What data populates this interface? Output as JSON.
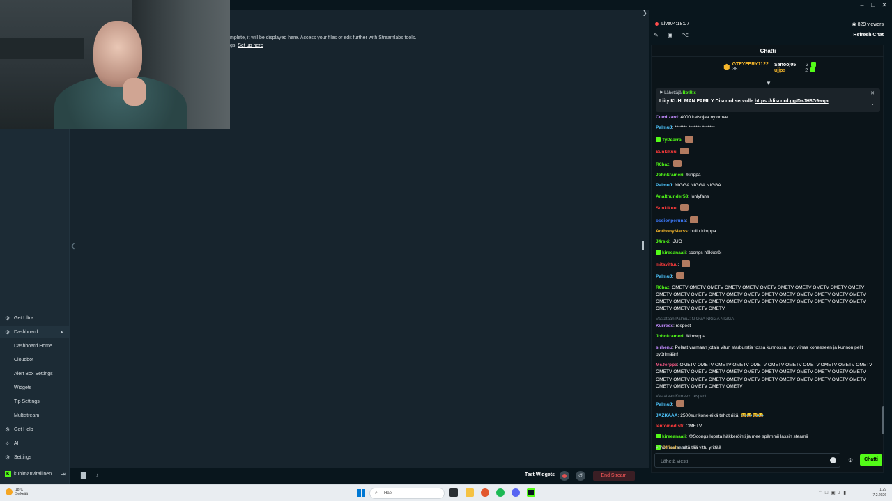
{
  "window": {
    "minimize": "–",
    "maximize": "□",
    "close": "✕"
  },
  "notice": {
    "line1": "mplete, it will be displayed here. Access your files or edit further with Streamlabs tools.",
    "line2_prefix": "gs.",
    "setup_link": "Set up here"
  },
  "sidebar": {
    "items": [
      {
        "label": "Get Ultra",
        "icon": "ultra-icon"
      },
      {
        "label": "Dashboard",
        "icon": "dashboard-icon"
      },
      {
        "label": "Dashboard Home"
      },
      {
        "label": "Cloudbot"
      },
      {
        "label": "Alert Box Settings"
      },
      {
        "label": "Widgets"
      },
      {
        "label": "Tip Settings"
      },
      {
        "label": "Multistream"
      },
      {
        "label": "Get Help",
        "icon": "help-icon"
      },
      {
        "label": "AI",
        "icon": "ai-icon"
      },
      {
        "label": "Settings",
        "icon": "gear-icon"
      }
    ],
    "user": "kuhlmanvirallinen",
    "user_logo": "K"
  },
  "bottombar": {
    "test_widgets": "Test Widgets",
    "end_stream": "End Stream"
  },
  "chat_panel": {
    "live_label": "Live",
    "live_time": "04:18:07",
    "viewers": "829 viewers",
    "refresh": "Refresh Chat",
    "title": "Chatti",
    "gifters": {
      "left_name": "GTFYFERY1122",
      "left_count": "38",
      "right": [
        {
          "name": "Sanooj05",
          "count": "2"
        },
        {
          "name": "ujjps",
          "count": "2"
        }
      ]
    },
    "pinned": {
      "sender_label": "Lähettäjä",
      "sender": "BotRix",
      "message": "Liity KUHLMAN FAMILY Discord servulle",
      "link": "https://discord.gg/DaJH8G9wqa"
    },
    "messages": [
      {
        "user": "Cumlizard",
        "color": "#c48cff",
        "text": "4000 katsojaa ny omee !"
      },
      {
        "user": "PalmuJ",
        "color": "#4fc7ff",
        "text": "******* ******* *******"
      },
      {
        "user": "TyPearra",
        "color": "#53fc18",
        "text": "",
        "badge": true,
        "emote": true
      },
      {
        "user": "Sunkikuu",
        "color": "#ff3b3b",
        "text": "",
        "emote": true
      },
      {
        "user": "R0baz",
        "color": "#53fc18",
        "text": "",
        "emote": true
      },
      {
        "user": "Johnkrameri",
        "color": "#53fc18",
        "text": "!kinppa"
      },
      {
        "user": "PalmuJ",
        "color": "#4fc7ff",
        "text": "NIGGA NIGGA NIGGA"
      },
      {
        "user": "Analthunder58",
        "color": "#53fc18",
        "text": "!onlyfans"
      },
      {
        "user": "Sunkikuu",
        "color": "#ff3b3b",
        "text": "",
        "emote": true
      },
      {
        "user": "ossionperuna",
        "color": "#3d7bff",
        "text": "",
        "emote": true
      },
      {
        "user": "AnthonyMarss",
        "color": "#f5b62b",
        "text": "huilu kimppa"
      },
      {
        "user": "J4rski",
        "color": "#53fc18",
        "text": "!JUO"
      },
      {
        "user": "kireeanaali",
        "color": "#53fc18",
        "text": "scongs häkkeröi",
        "badge": true
      },
      {
        "user": "mitavittuu",
        "color": "#ff3b3b",
        "text": "",
        "emote": true
      },
      {
        "user": "PalmuJ",
        "color": "#4fc7ff",
        "text": "",
        "emote": true
      },
      {
        "user": "R0baz",
        "color": "#53fc18",
        "text": "OMETV OMETV OMETV OMETV OMETV OMETV OMETV OMETV OMETV OMETV OMETV OMETV OMETV OMETV OMETV OMETV OMETV OMETV OMETV OMETV OMETV OMETV OMETV OMETV OMETV OMETV OMETV OMETV OMETV OMETV OMETV OMETV OMETV OMETV OMETV OMETV OMETV OMETV OMETV"
      },
      {
        "reply": "Vastataan PalmuJ: NIGGA NIGGA NIGGA",
        "user": "Kurreex",
        "color": "#c48cff",
        "text": "respect"
      },
      {
        "user": "Johnkrameri",
        "color": "#53fc18",
        "text": "!kimwppa"
      },
      {
        "user": "sirhenu",
        "color": "#c48cff",
        "text": "Pelaat varmaan jotain vitun starburstia tossa kunnossa, nyt viinaa koneeseen ja kunnon pelit pyörimään!"
      },
      {
        "user": "McJerppa",
        "color": "#ff5b8a",
        "text": "OMETV OMETV OMETV OMETV OMETV OMETV OMETV OMETV OMETV OMETV OMETV OMETV OMETV OMETV OMETV OMETV OMETV OMETV OMETV OMETV OMETV OMETV OMETV OMETV OMETV OMETV OMETV OMETV OMETV OMETV OMETV OMETV OMETV OMETV OMETV OMETV OMETV OMETV OMETV OMETV"
      },
      {
        "reply": "Vastataan Kurreex: respect",
        "user": "PalmuJ",
        "color": "#4fc7ff",
        "text": "",
        "emote": true
      },
      {
        "user": "JAZKAAA",
        "color": "#4fc7ff",
        "text": "2500eur kone eikä tehot riitä. 😂😂😂😂"
      },
      {
        "user": "lentomodisti",
        "color": "#ff3b3b",
        "text": "OMETV"
      },
      {
        "user": "kireeanaali",
        "color": "#53fc18",
        "text": "@Scongs lopeta häkkeröinti ja mee spämmii lassin steamii",
        "badge": true
      },
      {
        "user": "Officals",
        "color": "#f5b62b",
        "text": "mitä tää vittu yrittää",
        "badge": true
      }
    ],
    "subs_only": "Vain seuraajat",
    "input_placeholder": "Lähetä viesti",
    "send": "Chatti"
  },
  "taskbar": {
    "weather_temp": "18°C",
    "weather_desc": "Selkeää",
    "search_placeholder": "Hae",
    "time": "1.29",
    "date": "7.2.2026"
  }
}
